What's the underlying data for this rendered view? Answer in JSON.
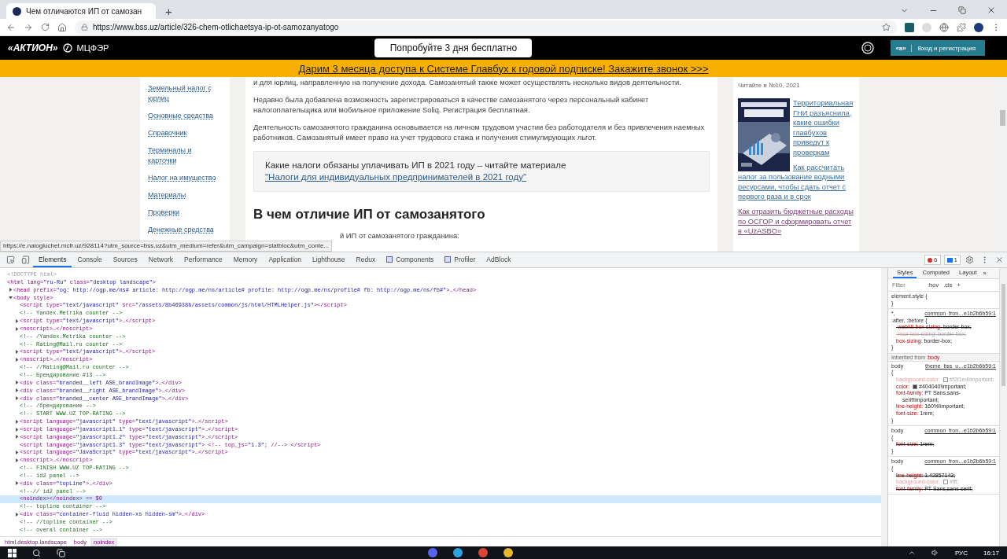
{
  "browser": {
    "tabs": [
      {
        "title": "Чем отличаются ИП от самозан",
        "selected": true
      }
    ],
    "new_tab": "+",
    "url": "https://www.bss.uz/article/326-chem-otlichaetsya-ip-ot-samozanyatogo"
  },
  "site_header": {
    "logo_left": "«АКТИОН»",
    "logo_right": "МЦФЭР",
    "trial_button": "Попробуйте 3 дня бесплатно",
    "login_badge": "«а»",
    "login_button": "Вход и регистрация"
  },
  "promo_banner": "Дарим 3 месяца доступа к Системе Главбух к годовой подписке! Закажите звонок >>>",
  "left_menu": [
    {
      "label": "Земельный налог с юрлиц"
    },
    {
      "label": "Основные средства"
    },
    {
      "label": "Справочник"
    },
    {
      "label": "Терминалы и карточки"
    },
    {
      "label": "Налог на имущество"
    },
    {
      "label": "Материалы"
    },
    {
      "label": "Проверки"
    },
    {
      "label": "Денежные средства"
    }
  ],
  "article": {
    "paragraphs": [
      "и для юрлиц, направленную на получение дохода. Самозанятый также может осуществлять несколько видов деятельности.",
      "Недавно была добавлена возможность зарегистрироваться в качестве самозанятого через персональный кабинет налогоплательщика или мобильное приложение Soliq. Регистрация бесплатная.",
      "Деятельность самозанятого гражданина основывается на личном трудовом участии без работодателя и без привлечения наемных работников. Самозанятый имеет право на учет трудового стажа и получения стимулирующих льгот."
    ],
    "callout": {
      "text": "Какие налоги обязаны уплачивать ИП в 2021 году – читайте материале",
      "link": "\"Налоги для индивидуальных предпринимателей в 2021 году\""
    },
    "heading": "В чем отличие ИП от самозанятого",
    "partial_line": "й ИП от самозанятого гражданина:"
  },
  "right_sidebar": {
    "issue": "Читайте в №10, 2021",
    "links": [
      {
        "text": "Территориальная ГНИ разъяснила, какие ошибки главбухов приведут к проверкам",
        "visited": false
      },
      {
        "text": "Как рассчитать налог за пользование водными ресурсами, чтобы сдать отчет с первого раза и в срок",
        "visited": false
      },
      {
        "text": "Как отразить бюджетные расходы по ОСГОР и сформировать отчет в «UzASBO»",
        "visited": true
      }
    ]
  },
  "status_url": "https://e.nalogiuchet.mcfr.uz/928114?utm_source=bss.uz&utm_medium=refer&utm_campaign=statbloc&utm_conte...",
  "devtools": {
    "tabs": [
      {
        "label": "Elements",
        "selected": true,
        "icon": false
      },
      {
        "label": "Console",
        "selected": false,
        "icon": false
      },
      {
        "label": "Sources",
        "selected": false,
        "icon": false
      },
      {
        "label": "Network",
        "selected": false,
        "icon": false
      },
      {
        "label": "Performance",
        "selected": false,
        "icon": false
      },
      {
        "label": "Memory",
        "selected": false,
        "icon": false
      },
      {
        "label": "Application",
        "selected": false,
        "icon": false
      },
      {
        "label": "Lighthouse",
        "selected": false,
        "icon": false
      },
      {
        "label": "Redux",
        "selected": false,
        "icon": false
      },
      {
        "label": "Components",
        "selected": false,
        "icon": true
      },
      {
        "label": "Profiler",
        "selected": false,
        "icon": true
      },
      {
        "label": "AdBlock",
        "selected": false,
        "icon": false
      }
    ],
    "errors": "6",
    "messages": "1",
    "tree": [
      {
        "text": "<!DOCTYPE html>",
        "kind": "doctype",
        "selected": false
      },
      {
        "text": "<html lang=\"ru-Ru\" class=\"desktop landscape\">",
        "kind": "tag",
        "selected": false,
        "children": [
          {
            "text": "<head prefix=\"og: http://ogp.me/ns# article: http://ogp.me/ns/article# profile: http://ogp.me/ns/profile# fb: http://ogp.me/ns/fb#\">…</head>",
            "kind": "tag",
            "selected": false,
            "expanded": false
          },
          {
            "text": "<body style>",
            "kind": "tag",
            "selected": false,
            "expanded": true,
            "children": [
              {
                "text": "<script type=\"text/javascript\" src=\"/assets/8b46938b/assets/common/js/html/HTMLHelper.js\"></script>",
                "kind": "tag",
                "selected": false
              },
              {
                "text": "<!-- Yandex.Metrika counter -->",
                "kind": "comment",
                "selected": false
              },
              {
                "text": "<script type=\"text/javascript\">…</script>",
                "kind": "tag",
                "selected": false,
                "expanded": false
              },
              {
                "text": "<noscript>…</noscript>",
                "kind": "tag",
                "selected": false,
                "expanded": false
              },
              {
                "text": "<!-- /Yandex.Metrika counter -->",
                "kind": "comment",
                "selected": false
              },
              {
                "text": "<!-- Rating@Mail.ru counter -->",
                "kind": "comment",
                "selected": false
              },
              {
                "text": "<script type=\"text/javascript\">…</script>",
                "kind": "tag",
                "selected": false,
                "expanded": false
              },
              {
                "text": "<noscript>…</noscript>",
                "kind": "tag",
                "selected": false,
                "expanded": false
              },
              {
                "text": "<!-- //Rating@Mail.ru counter -->",
                "kind": "comment",
                "selected": false
              },
              {
                "text": "<!-- Брендирование #13 -->",
                "kind": "comment",
                "selected": false
              },
              {
                "text": "<div class=\"branded__left ASE_brandImage\">…</div>",
                "kind": "tag",
                "selected": false,
                "expanded": false
              },
              {
                "text": "<div class=\"branded__right ASE_brandImage\">…</div>",
                "kind": "tag",
                "selected": false,
                "expanded": false
              },
              {
                "text": "<div class=\"branded__center ASE_brandImage\">…</div>",
                "kind": "tag",
                "selected": false,
                "expanded": false
              },
              {
                "text": "<!-- /брендирование -->",
                "kind": "comment",
                "selected": false
              },
              {
                "text": "<!-- START WWW.UZ TOP-RATING -->",
                "kind": "comment",
                "selected": false
              },
              {
                "text": "<script language=\"javascript\" type=\"text/javascript\">…</script>",
                "kind": "tag",
                "selected": false,
                "expanded": false
              },
              {
                "text": "<script language=\"javascript1.1\" type=\"text/javascript\">…</script>",
                "kind": "tag",
                "selected": false,
                "expanded": false
              },
              {
                "text": "<script language=\"javascript1.2\" type=\"text/javascript\">…</script>",
                "kind": "tag",
                "selected": false,
                "expanded": false
              },
              {
                "text": "<script language=\"javascript1.3\" type=\"text/javascript\"> <!-- top_js=\"1.3\"; //--> </script>",
                "kind": "tag",
                "selected": false
              },
              {
                "text": "<script language=\"JavaScript\" type=\"text/javascript\">…</script>",
                "kind": "tag",
                "selected": false,
                "expanded": false
              },
              {
                "text": "<noscript>…</noscript>",
                "kind": "tag",
                "selected": false,
                "expanded": false
              },
              {
                "text": "<!-- FINISH WWW.UZ TOP-RATING -->",
                "kind": "comment",
                "selected": false
              },
              {
                "text": "<!-- id2 panel -->",
                "kind": "comment",
                "selected": false
              },
              {
                "text": "<div class=\"topLine\">…</div>",
                "kind": "tag",
                "selected": false,
                "expanded": false
              },
              {
                "text": "<!--// id2 panel -->",
                "kind": "comment",
                "selected": false
              },
              {
                "text": "<noindex></noindex> == $0",
                "kind": "tag",
                "selected": true
              },
              {
                "text": "<!-- topline container -->",
                "kind": "comment",
                "selected": false
              },
              {
                "text": "<div class=\"container-fluid hidden-xs hidden-sm\">…</div>",
                "kind": "tag",
                "selected": false,
                "expanded": false
              },
              {
                "text": "<!-- //topline container -->",
                "kind": "comment",
                "selected": false
              },
              {
                "text": "<!-- overal container -->",
                "kind": "comment",
                "selected": false
              }
            ]
          }
        ]
      }
    ],
    "breadcrumbs": [
      {
        "label": "html.desktop.landscape",
        "selected": false
      },
      {
        "label": "body",
        "selected": false
      },
      {
        "label": "noindex",
        "selected": true
      }
    ],
    "styles": {
      "tabs": [
        {
          "label": "Styles",
          "selected": true
        },
        {
          "label": "Computed",
          "selected": false
        },
        {
          "label": "Layout",
          "selected": false
        }
      ],
      "more": "»",
      "filter_placeholder": "Filter",
      "hov": ":hov",
      "cls": ".cls",
      "add": "+",
      "rules": [
        {
          "selector_lines": [
            "element.style {"
          ],
          "close": "}"
        },
        {
          "selector_lines": [
            "*,",
            ":after, :before {"
          ],
          "source": "common_fron…e1b2b6b59:1",
          "close": "}",
          "declarations": [
            {
              "property": "-webkit-box-sizing:",
              "value": "border-box;",
              "overridden": true,
              "dimmed": false
            },
            {
              "property": "-moz-box-sizing:",
              "value": "border-box;",
              "overridden": true,
              "dimmed": true
            },
            {
              "property": "box-sizing:",
              "value": "border-box;",
              "overridden": false,
              "dimmed": false
            }
          ]
        },
        {
          "inherited_label": "Inherited from",
          "inherited_from": "body",
          "selector_lines": [
            "body",
            "{"
          ],
          "source": "theme_bss_u…e1b2b6b59:1",
          "close": "}",
          "declarations": [
            {
              "property": "background-color:",
              "value": "#f2f1ed!important;",
              "overridden": false,
              "dimmed": true,
              "color": "#f2f1ed"
            },
            {
              "property": "color:",
              "value": "#404040!important;",
              "overridden": false,
              "dimmed": false,
              "color": "#404040"
            },
            {
              "property": "font-family:",
              "value": "PT Sans,sans-serif!important;",
              "overridden": false,
              "dimmed": false
            },
            {
              "property": "line-height:",
              "value": "160%!important;",
              "overridden": false,
              "dimmed": false
            },
            {
              "property": "font-size:",
              "value": "1rem;",
              "overridden": false,
              "dimmed": false
            }
          ]
        },
        {
          "selector_lines": [
            "body",
            "{"
          ],
          "source": "common_fron…e1b2b6b59:1",
          "close": "}",
          "declarations": [
            {
              "property": "font-size:",
              "value": "1rem;",
              "overridden": true,
              "dimmed": false
            }
          ]
        },
        {
          "selector_lines": [
            "body",
            "{"
          ],
          "source": "common_fron…e1b2b6b59:1",
          "declarations": [
            {
              "property": "line-height:",
              "value": "1.42857143;",
              "overridden": true,
              "dimmed": false
            },
            {
              "property": "background-color:",
              "value": "#fff;",
              "overridden": false,
              "dimmed": true,
              "color": "#ffffff"
            },
            {
              "property": "font-family:",
              "value": "PT Sans,sans-serif;",
              "overridden": true,
              "dimmed": false
            }
          ]
        }
      ]
    }
  },
  "taskbar": {
    "language": "РУС",
    "time": "16:17"
  }
}
